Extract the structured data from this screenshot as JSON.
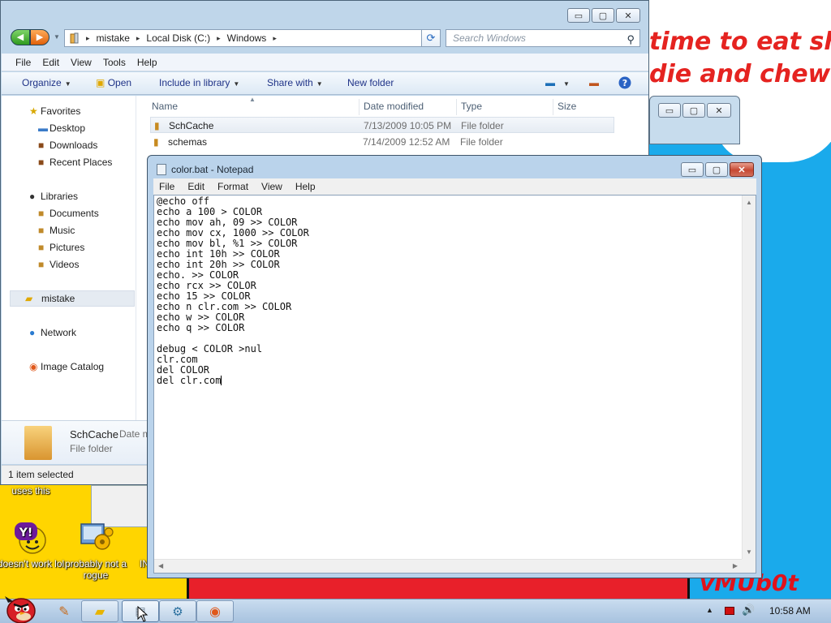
{
  "wallpaper": {
    "text": "time to eat shit\ndie and chew\nn",
    "signature": "vMUb0t"
  },
  "desktop_icons": [
    {
      "label": "uses this",
      "icon": "shortcut-icon"
    },
    {
      "label": "doesn't work lol",
      "icon": "yahoo-messenger-icon"
    },
    {
      "label": "probably not a rogue",
      "icon": "gears-program-icon"
    },
    {
      "label": "IN",
      "icon": "partial-icon"
    }
  ],
  "explorer": {
    "window_buttons": {
      "minimize": "▭",
      "maximize": "▢",
      "close": "✕"
    },
    "nav": {
      "back": "◀",
      "forward": "▶",
      "recent": "▼"
    },
    "address": {
      "crumbs": [
        "mistake",
        "Local Disk (C:)",
        "Windows"
      ],
      "separator": "▸"
    },
    "search_placeholder": "Search Windows",
    "menu": [
      "File",
      "Edit",
      "View",
      "Tools",
      "Help"
    ],
    "toolbar": {
      "organize": "Organize",
      "open": "Open",
      "include": "Include in library",
      "share": "Share with",
      "new_folder": "New folder"
    },
    "nav_pane": {
      "favorites_header": "Favorites",
      "favorites": [
        "Desktop",
        "Downloads",
        "Recent Places"
      ],
      "libraries_header": "Libraries",
      "libraries": [
        "Documents",
        "Music",
        "Pictures",
        "Videos"
      ],
      "homegroup": "mistake",
      "network": "Network",
      "catalog": "Image Catalog"
    },
    "columns": [
      "Name",
      "Date modified",
      "Type",
      "Size"
    ],
    "rows": [
      {
        "name": "SchCache",
        "date": "7/13/2009 10:05 PM",
        "type": "File folder",
        "selected": true
      },
      {
        "name": "schemas",
        "date": "7/14/2009 12:52 AM",
        "type": "File folder",
        "selected": false
      }
    ],
    "details": {
      "name": "SchCache",
      "date_label": "Date m",
      "type": "File folder"
    },
    "status": "1 item selected"
  },
  "notepad": {
    "title": "color.bat - Notepad",
    "menu": [
      "File",
      "Edit",
      "Format",
      "View",
      "Help"
    ],
    "content": "@echo off\necho a 100 > COLOR\necho mov ah, 09 >> COLOR\necho mov cx, 1000 >> COLOR\necho mov bl, %1 >> COLOR\necho int 10h >> COLOR\necho int 20h >> COLOR\necho. >> COLOR\necho rcx >> COLOR\necho 15 >> COLOR\necho n clr.com >> COLOR\necho w >> COLOR\necho q >> COLOR\n\ndebug < COLOR >nul\nclr.com\ndel COLOR\ndel clr.com"
  },
  "taskbar": {
    "time": "10:58 AM",
    "buttons": [
      "pen-program-icon",
      "explorer-folder-icon",
      "notepad-icon",
      "program-icon",
      "catalog-icon"
    ],
    "tray": {
      "show_hidden": "▲",
      "volume": "🔊"
    }
  },
  "colors": {
    "desktop_blue": "#1aaaeb",
    "wall_text_red": "#e52320",
    "taskbar": "#bcd1e7",
    "window_frame": "#bfd6ea"
  }
}
